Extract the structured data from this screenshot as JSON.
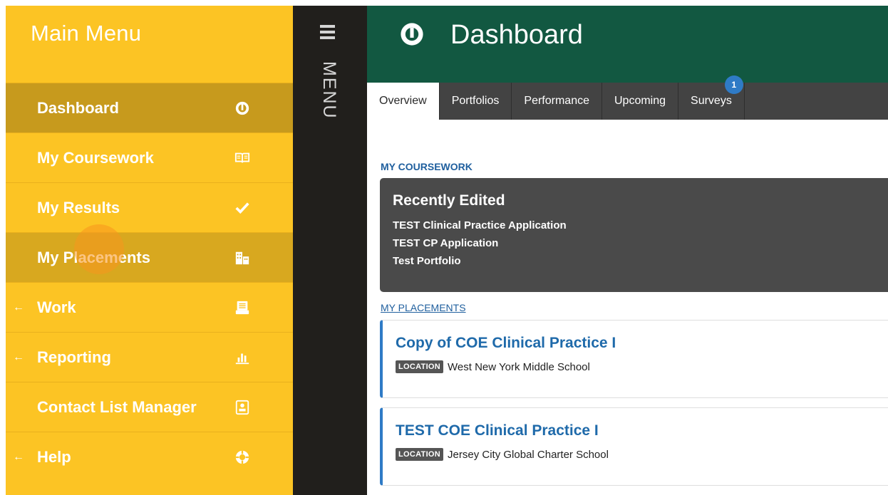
{
  "sidebar": {
    "title": "Main Menu",
    "items": [
      {
        "label": "Dashboard",
        "icon": "dashboard-gauge-icon"
      },
      {
        "label": "My Coursework",
        "icon": "open-book-icon"
      },
      {
        "label": "My Results",
        "icon": "checkmark-icon"
      },
      {
        "label": "My Placements",
        "icon": "buildings-icon"
      },
      {
        "label": "Work",
        "arrow": "←",
        "icon": "inbox-tray-icon"
      },
      {
        "label": "Reporting",
        "arrow": "←",
        "icon": "bar-chart-icon"
      },
      {
        "label": "Contact List Manager",
        "icon": "contact-card-icon"
      },
      {
        "label": "Help",
        "arrow": "←",
        "icon": "lifebuoy-icon"
      }
    ]
  },
  "menu_strip": {
    "label": "MENU"
  },
  "header": {
    "title": "Dashboard"
  },
  "tabs": [
    {
      "label": "Overview"
    },
    {
      "label": "Portfolios"
    },
    {
      "label": "Performance"
    },
    {
      "label": "Upcoming"
    },
    {
      "label": "Surveys",
      "badge": "1"
    }
  ],
  "coursework": {
    "section_label": "MY COURSEWORK",
    "recent_title": "Recently Edited",
    "items": [
      "TEST Clinical Practice Application",
      "TEST CP Application",
      "Test Portfolio"
    ]
  },
  "placements": {
    "section_label": "MY PLACEMENTS",
    "location_badge": "LOCATION",
    "items": [
      {
        "title": "Copy of COE Clinical Practice I",
        "location": "West New York Middle School"
      },
      {
        "title": "TEST COE Clinical Practice I",
        "location": "Jersey City Global Charter School"
      }
    ]
  },
  "colors": {
    "sidebar": "#fcc424",
    "sidebar_active": "#c79a1d",
    "header": "#125841",
    "tabs": "#434343",
    "link": "#1f5f9e"
  }
}
